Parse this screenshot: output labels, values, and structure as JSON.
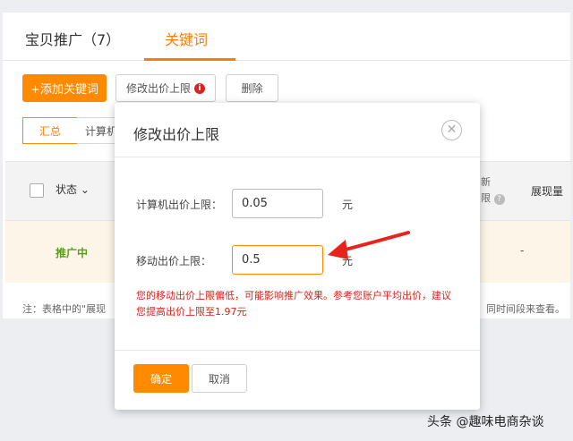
{
  "tabs": [
    {
      "label": "宝贝推广（7）"
    },
    {
      "label": "关键词"
    }
  ],
  "toolbar": {
    "add_keyword": "+添加关键词",
    "edit_limit": "修改出价上限",
    "delete": "删除"
  },
  "segments": {
    "summary": "汇总",
    "pc": "计算机"
  },
  "table": {
    "headers": {
      "status": "状态",
      "partial_col": "新\n限",
      "impressions": "展现量"
    },
    "row": {
      "status": "推广中",
      "impressions": "-"
    }
  },
  "footnote": {
    "left": "注：表格中的\"展现",
    "right": "同时间段来查看。"
  },
  "modal": {
    "title": "修改出价上限",
    "close_icon": "close-icon",
    "pc_label": "计算机出价上限：",
    "pc_value": "0.05",
    "mobile_label": "移动出价上限：",
    "mobile_value": "0.5",
    "unit": "元",
    "warning": "您的移动出价上限偏低，可能影响推广效果。参考您账户平均出价，建议您提高出价上限至1.97元",
    "ok": "确定",
    "cancel": "取消"
  },
  "annotation": {
    "arrow_color": "#e8231c"
  },
  "watermark": "头条 @趣味电商杂谈",
  "colors": {
    "accent": "#ff8a00",
    "warning": "#e0201b",
    "status_active": "#5a9e1a"
  }
}
